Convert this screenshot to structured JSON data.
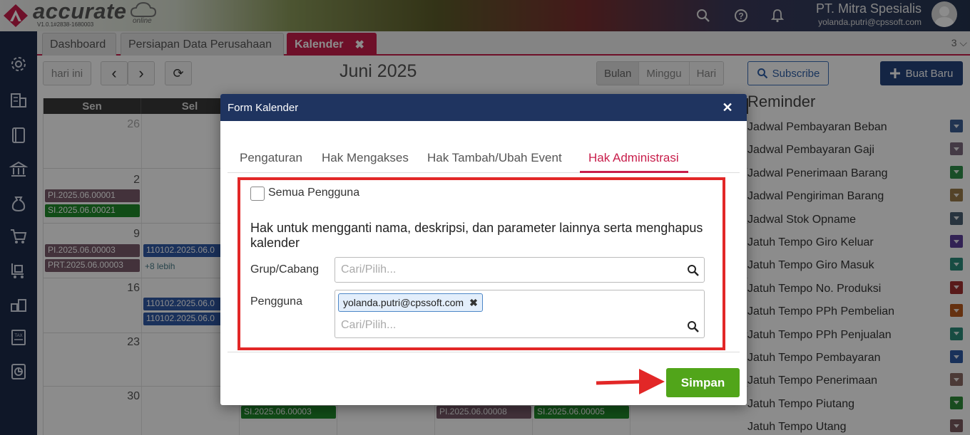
{
  "header": {
    "logo_text": "accurate",
    "logo_sub": "online",
    "version": "V1.0.1#2838-1680003",
    "company_name": "PT. Mitra Spesialis",
    "user_email": "yolanda.putri@cpssoft.com"
  },
  "tabs": [
    {
      "label": "Dashboard"
    },
    {
      "label": "Persiapan Data Perusahaan"
    },
    {
      "label": "Kalender",
      "close": "✖"
    }
  ],
  "tab_count": "3 ⌵",
  "calendar": {
    "today_label": "hari ini",
    "prev": "‹",
    "next": "›",
    "refresh": "⟳",
    "title": "Juni 2025",
    "views": [
      "Bulan",
      "Minggu",
      "Hari"
    ],
    "day_headers": [
      "Sen",
      "Sel"
    ],
    "dates": [
      "26",
      "2",
      "9",
      "16",
      "23",
      "30"
    ],
    "events": {
      "pi_0001": "PI.2025.06.00001",
      "si_0021": "SI.2025.06.00021",
      "pi_0003": "PI.2025.06.00003",
      "prt_0003": "PRT.2025.06.00003",
      "b1": "110102.2025.06.0",
      "more": "+8 lebih",
      "b2": "110102.2025.06.0",
      "b3": "110102.2025.06.0",
      "si_0003": "SI.2025.06.00003",
      "pi_0008": "PI.2025.06.00008",
      "si_0005": "SI.2025.06.00005"
    }
  },
  "right": {
    "subscribe": "Subscribe",
    "new_button": "Buat Baru",
    "reminder_title": "Reminder",
    "reminders": [
      {
        "label": "Jadwal Pembayaran Beban",
        "color": "#3d5f94"
      },
      {
        "label": "Jadwal Pembayaran Gaji",
        "color": "#7d6b7f"
      },
      {
        "label": "Jadwal Penerimaan Barang",
        "color": "#2e8f4a"
      },
      {
        "label": "Jadwal Pengiriman Barang",
        "color": "#9a7a4a"
      },
      {
        "label": "Jadwal Stok Opname",
        "color": "#4a5f73"
      },
      {
        "label": "Jatuh Tempo Giro Keluar",
        "color": "#5b3f9a"
      },
      {
        "label": "Jatuh Tempo Giro Masuk",
        "color": "#2a8a7a"
      },
      {
        "label": "Jatuh Tempo No. Produksi",
        "color": "#a13030"
      },
      {
        "label": "Jatuh Tempo PPh Pembelian",
        "color": "#b85a1e"
      },
      {
        "label": "Jatuh Tempo PPh Penjualan",
        "color": "#2a8a78"
      },
      {
        "label": "Jatuh Tempo Pembayaran",
        "color": "#2f5aa5"
      },
      {
        "label": "Jatuh Tempo Penerimaan",
        "color": "#8a6a64"
      },
      {
        "label": "Jatuh Tempo Piutang",
        "color": "#2e8a3a"
      },
      {
        "label": "Jatuh Tempo Utang",
        "color": "#7a5a60"
      }
    ]
  },
  "modal": {
    "title": "Form Kalender",
    "close": "✕",
    "tabs": [
      "Pengaturan",
      "Hak Mengakses",
      "Hak Tambah/Ubah Event",
      "Hak Administrasi"
    ],
    "all_users_label": "Semua Pengguna",
    "description": "Hak untuk mengganti nama, deskripsi, dan parameter lainnya serta menghapus kalender",
    "group_label": "Grup/Cabang",
    "group_placeholder": "Cari/Pilih...",
    "user_label": "Pengguna",
    "user_chip": "yolanda.putri@cpssoft.com",
    "user_chip_remove": "✖",
    "user_placeholder": "Cari/Pilih...",
    "save_label": "Simpan"
  },
  "colors": {
    "accent": "#c81e4b",
    "modal_header": "#1f3460",
    "save": "#51a51a",
    "highlight": "#e22727"
  }
}
